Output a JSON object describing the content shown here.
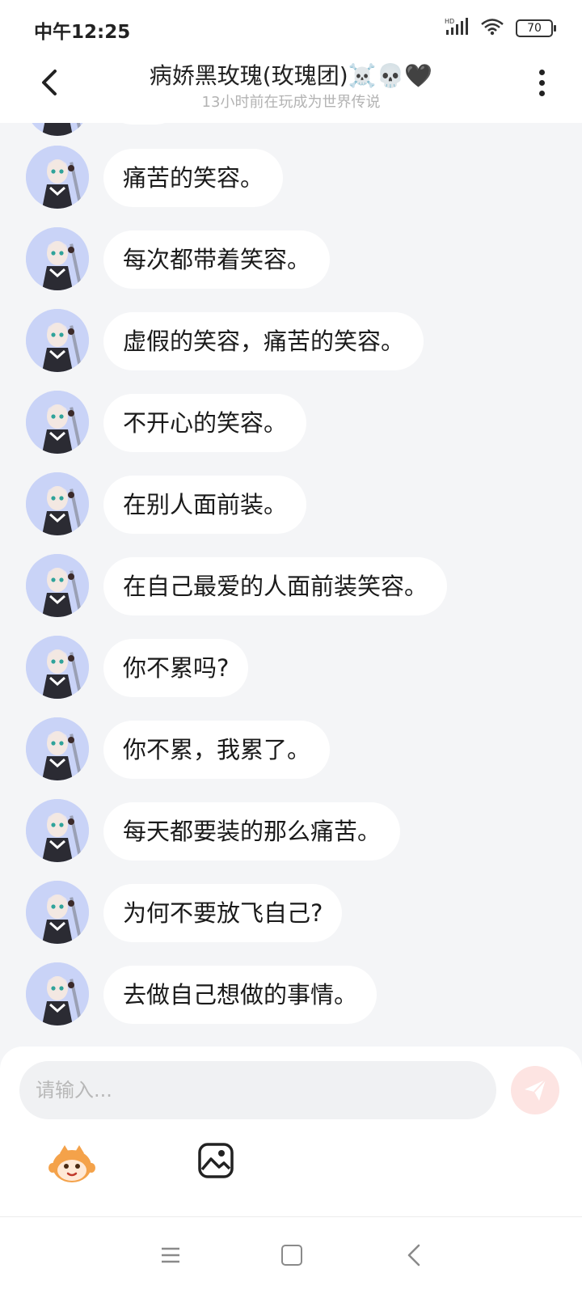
{
  "status_bar": {
    "time": "中午12:25",
    "battery": "70",
    "signal_label": "HD"
  },
  "header": {
    "title": "病娇黑玫瑰(玫瑰团)☠️💀🖤",
    "subtitle": "13小时前在玩成为世界传说"
  },
  "messages": [
    {
      "text": "痛苦的笑容。"
    },
    {
      "text": "每次都带着笑容。"
    },
    {
      "text": "虚假的笑容，痛苦的笑容。"
    },
    {
      "text": "不开心的笑容。"
    },
    {
      "text": "在别人面前装。"
    },
    {
      "text": "在自己最爱的人面前装笑容。"
    },
    {
      "text": "你不累吗?"
    },
    {
      "text": "你不累，我累了。"
    },
    {
      "text": "每天都要装的那么痛苦。"
    },
    {
      "text": "为何不要放飞自己?"
    },
    {
      "text": "去做自己想做的事情。"
    }
  ],
  "input": {
    "placeholder": "请输入..."
  },
  "icons": {
    "back": "chevron-left-icon",
    "more": "more-vertical-icon",
    "send": "send-icon",
    "emoji": "emoji-icon",
    "image": "image-icon"
  },
  "colors": {
    "send_button": "#fde4e2",
    "avatar_bg": "#c9d3f7",
    "background": "#f4f5f7"
  }
}
